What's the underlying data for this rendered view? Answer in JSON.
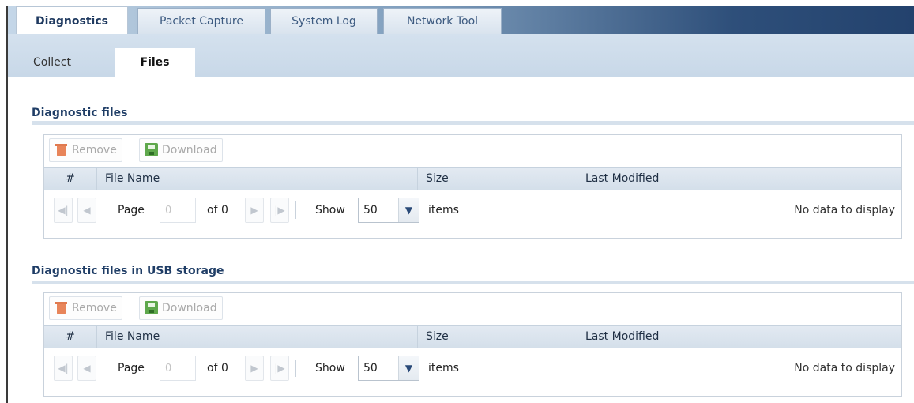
{
  "tabs": [
    {
      "label": "Diagnostics",
      "active": true
    },
    {
      "label": "Packet Capture",
      "active": false
    },
    {
      "label": "System Log",
      "active": false
    },
    {
      "label": "Network Tool",
      "active": false
    }
  ],
  "subtabs": [
    {
      "label": "Collect",
      "active": false
    },
    {
      "label": "Files",
      "active": true
    }
  ],
  "sections": [
    {
      "title": "Diagnostic files",
      "toolbar": {
        "remove": "Remove",
        "download": "Download"
      },
      "columns": [
        "#",
        "File Name",
        "Size",
        "Last Modified"
      ],
      "pager": {
        "page_label": "Page",
        "page_value": "0",
        "of_label": "of 0",
        "show_label": "Show",
        "show_value": "50",
        "items_label": "items",
        "status": "No data to display"
      }
    },
    {
      "title": "Diagnostic files in USB storage",
      "toolbar": {
        "remove": "Remove",
        "download": "Download"
      },
      "columns": [
        "#",
        "File Name",
        "Size",
        "Last Modified"
      ],
      "pager": {
        "page_label": "Page",
        "page_value": "0",
        "of_label": "of 0",
        "show_label": "Show",
        "show_value": "50",
        "items_label": "items",
        "status": "No data to display"
      }
    }
  ],
  "colors": {
    "accent": "#1f3d66",
    "tab_bar_dark": "#23426d",
    "remove_icon": "#e8855a",
    "download_icon": "#5fa84c"
  }
}
